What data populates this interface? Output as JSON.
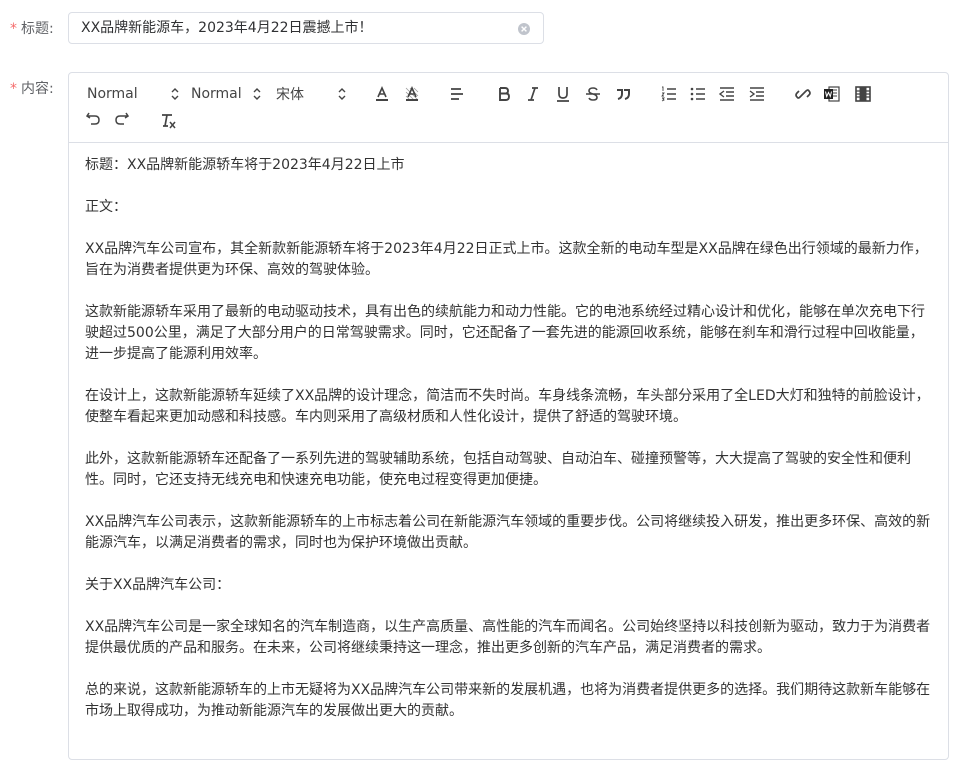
{
  "form": {
    "title_label": "标题:",
    "content_label": "内容:",
    "title_value": "XX品牌新能源车，2023年4月22日震撼上市！"
  },
  "toolbar": {
    "header_select": "Normal",
    "size_select": "Normal",
    "font_select": "宋体"
  },
  "content": {
    "paragraphs": [
      "标题：XX品牌新能源轿车将于2023年4月22日上市",
      "",
      "正文：",
      "",
      "XX品牌汽车公司宣布，其全新款新能源轿车将于2023年4月22日正式上市。这款全新的电动车型是XX品牌在绿色出行领域的最新力作，旨在为消费者提供更为环保、高效的驾驶体验。",
      "",
      "这款新能源轿车采用了最新的电动驱动技术，具有出色的续航能力和动力性能。它的电池系统经过精心设计和优化，能够在单次充电下行驶超过500公里，满足了大部分用户的日常驾驶需求。同时，它还配备了一套先进的能源回收系统，能够在刹车和滑行过程中回收能量，进一步提高了能源利用效率。",
      "",
      "在设计上，这款新能源轿车延续了XX品牌的设计理念，简洁而不失时尚。车身线条流畅，车头部分采用了全LED大灯和独特的前脸设计，使整车看起来更加动感和科技感。车内则采用了高级材质和人性化设计，提供了舒适的驾驶环境。",
      "",
      "此外，这款新能源轿车还配备了一系列先进的驾驶辅助系统，包括自动驾驶、自动泊车、碰撞预警等，大大提高了驾驶的安全性和便利性。同时，它还支持无线充电和快速充电功能，使充电过程变得更加便捷。",
      "",
      "XX品牌汽车公司表示，这款新能源轿车的上市标志着公司在新能源汽车领域的重要步伐。公司将继续投入研发，推出更多环保、高效的新能源汽车，以满足消费者的需求，同时也为保护环境做出贡献。",
      "",
      "关于XX品牌汽车公司：",
      "",
      "XX品牌汽车公司是一家全球知名的汽车制造商，以生产高质量、高性能的汽车而闻名。公司始终坚持以科技创新为驱动，致力于为消费者提供最优质的产品和服务。在未来，公司将继续秉持这一理念，推出更多创新的汽车产品，满足消费者的需求。",
      "",
      "总的来说，这款新能源轿车的上市无疑将为XX品牌汽车公司带来新的发展机遇，也将为消费者提供更多的选择。我们期待这款新车能够在市场上取得成功，为推动新能源汽车的发展做出更大的贡献。"
    ]
  }
}
